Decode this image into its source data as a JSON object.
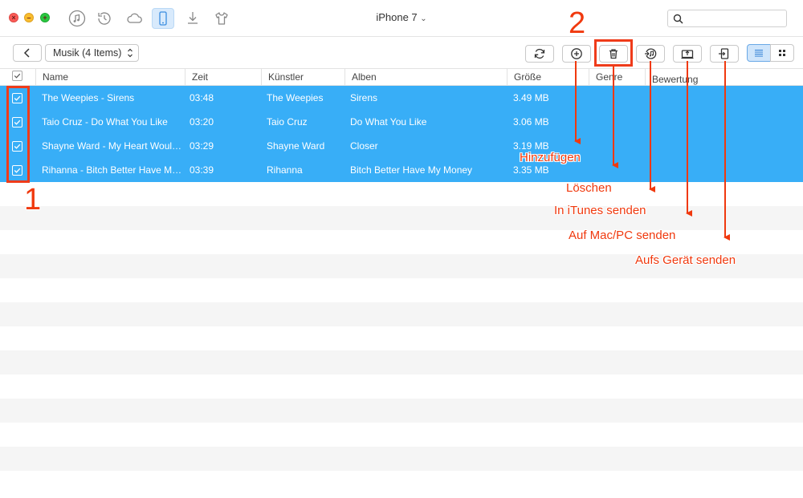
{
  "window": {
    "device_title": "iPhone 7",
    "search_placeholder": ""
  },
  "top_icons": [
    "music-note-icon",
    "history-icon",
    "cloud-icon",
    "phone-icon",
    "download-icon",
    "tshirt-icon"
  ],
  "toolbar": {
    "category_label": "Musik (4 Items)",
    "view_mode": "list"
  },
  "table": {
    "columns": {
      "name": "Name",
      "time": "Zeit",
      "artist": "Künstler",
      "album": "Alben",
      "size": "Größe",
      "genre": "Genre",
      "rating": "Bewertung"
    },
    "rows": [
      {
        "name": "The Weepies - Sirens",
        "time": "03:48",
        "artist": "The Weepies",
        "album": "Sirens",
        "size": "3.49 MB",
        "checked": true
      },
      {
        "name": "Taio Cruz - Do What You Like",
        "time": "03:20",
        "artist": "Taio Cruz",
        "album": "Do What You Like",
        "size": "3.06 MB",
        "checked": true
      },
      {
        "name": "Shayne Ward - My Heart Woul…",
        "time": "03:29",
        "artist": "Shayne Ward",
        "album": "Closer",
        "size": "3.19 MB",
        "checked": true
      },
      {
        "name": "Rihanna - Bitch Better Have M…",
        "time": "03:39",
        "artist": "Rihanna",
        "album": "Bitch Better Have My Money",
        "size": "3.35 MB",
        "checked": true
      }
    ]
  },
  "annotations": {
    "step1": "1",
    "step2": "2",
    "add": "Hinzufügen",
    "delete": "Löschen",
    "itunes": "In iTunes senden",
    "mac_pc": "Auf Mac/PC senden",
    "device": "Aufs Gerät senden"
  },
  "colors": {
    "selection": "#38aef7",
    "annotation": "#f0390e",
    "accent": "#2f8ee5"
  }
}
